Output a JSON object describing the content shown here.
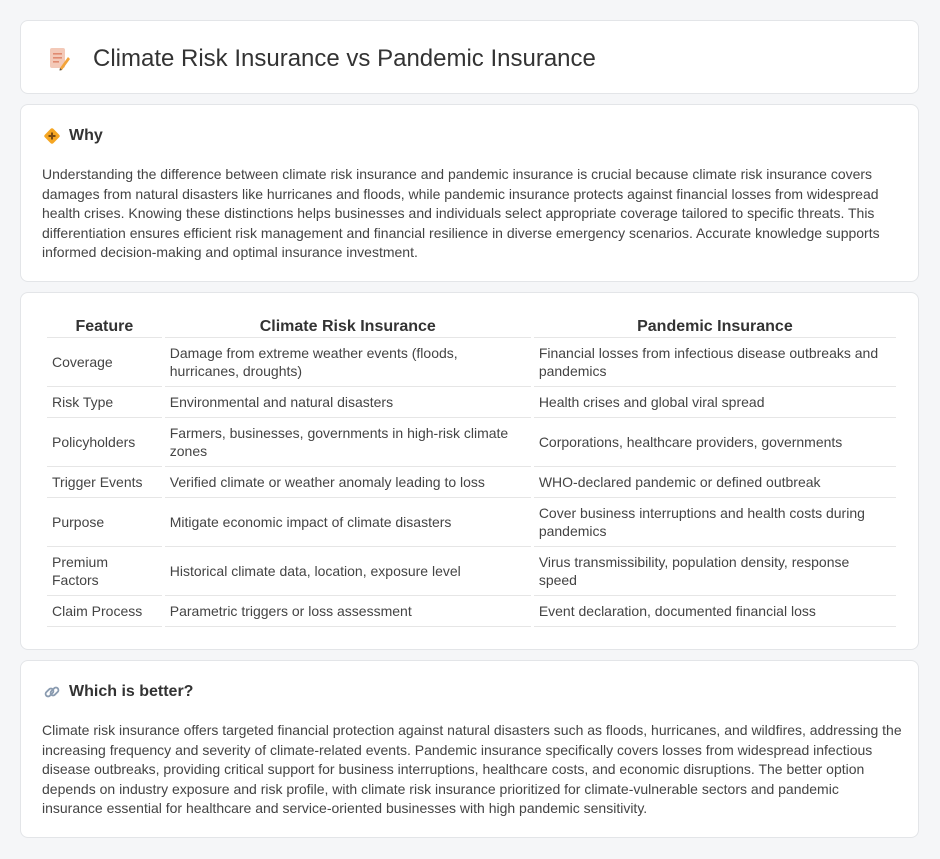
{
  "header": {
    "title": "Climate Risk Insurance vs Pandemic Insurance",
    "icon": "document-pen-icon"
  },
  "why": {
    "icon": "diamond-warning-icon",
    "heading": "Why",
    "text": "Understanding the difference between climate risk insurance and pandemic insurance is crucial because climate risk insurance covers damages from natural disasters like hurricanes and floods, while pandemic insurance protects against financial losses from widespread health crises. Knowing these distinctions helps businesses and individuals select appropriate coverage tailored to specific threats. This differentiation ensures efficient risk management and financial resilience in diverse emergency scenarios. Accurate knowledge supports informed decision-making and optimal insurance investment."
  },
  "table": {
    "headers": [
      "Feature",
      "Climate Risk Insurance",
      "Pandemic Insurance"
    ],
    "rows": [
      [
        "Coverage",
        "Damage from extreme weather events (floods, hurricanes, droughts)",
        "Financial losses from infectious disease outbreaks and pandemics"
      ],
      [
        "Risk Type",
        "Environmental and natural disasters",
        "Health crises and global viral spread"
      ],
      [
        "Policyholders",
        "Farmers, businesses, governments in high-risk climate zones",
        "Corporations, healthcare providers, governments"
      ],
      [
        "Trigger Events",
        "Verified climate or weather anomaly leading to loss",
        "WHO-declared pandemic or defined outbreak"
      ],
      [
        "Purpose",
        "Mitigate economic impact of climate disasters",
        "Cover business interruptions and health costs during pandemics"
      ],
      [
        "Premium Factors",
        "Historical climate data, location, exposure level",
        "Virus transmissibility, population density, response speed"
      ],
      [
        "Claim Process",
        "Parametric triggers or loss assessment",
        "Event declaration, documented financial loss"
      ]
    ]
  },
  "better": {
    "icon": "link-icon",
    "heading": "Which is better?",
    "text": "Climate risk insurance offers targeted financial protection against natural disasters such as floods, hurricanes, and wildfires, addressing the increasing frequency and severity of climate-related events. Pandemic insurance specifically covers losses from widespread infectious disease outbreaks, providing critical support for business interruptions, healthcare costs, and economic disruptions. The better option depends on industry exposure and risk profile, with climate risk insurance prioritized for climate-vulnerable sectors and pandemic insurance essential for healthcare and service-oriented businesses with high pandemic sensitivity."
  }
}
